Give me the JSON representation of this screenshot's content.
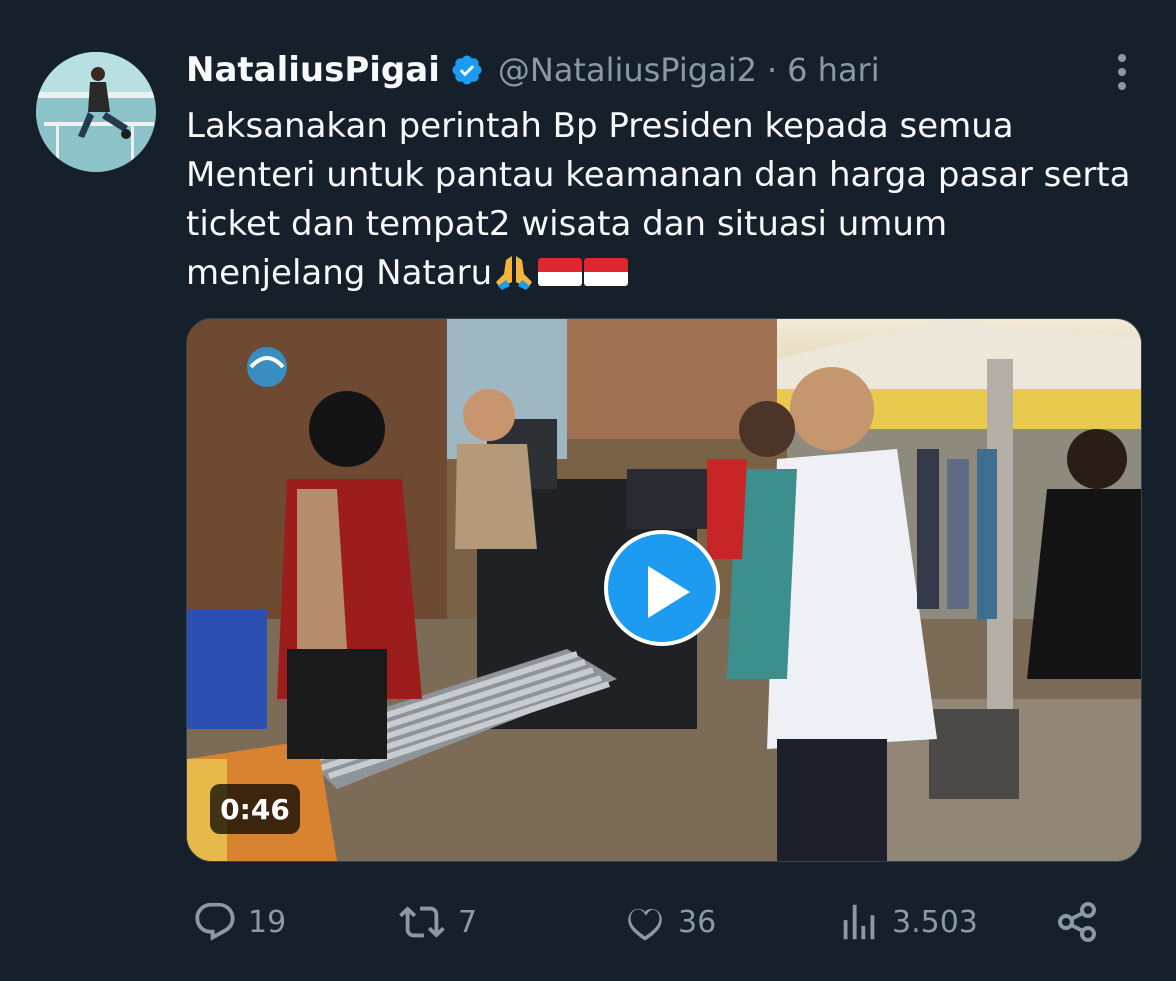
{
  "tweet": {
    "display_name": "NataliusPigai",
    "handle": "@NataliusPigai2",
    "separator": "·",
    "time": "6 hari",
    "text_lines": [
      "Laksanakan perintah Bp Presiden kepada semua",
      "Menteri untuk pantau keamanan dan harga pasar serta",
      "ticket dan tempat2 wisata dan situasi umum",
      "menjelang  Nataru"
    ],
    "emoji": [
      "folded-hands",
      "flag-indonesia",
      "flag-indonesia"
    ]
  },
  "media": {
    "duration": "0:46",
    "watermark_text": ""
  },
  "actions": {
    "replies": "19",
    "retweets": "7",
    "likes": "36",
    "views": "3.503"
  },
  "colors": {
    "background": "#15202b",
    "text": "#f7f9f9",
    "secondary": "#8b98a5",
    "accent": "#1d9bf0"
  }
}
